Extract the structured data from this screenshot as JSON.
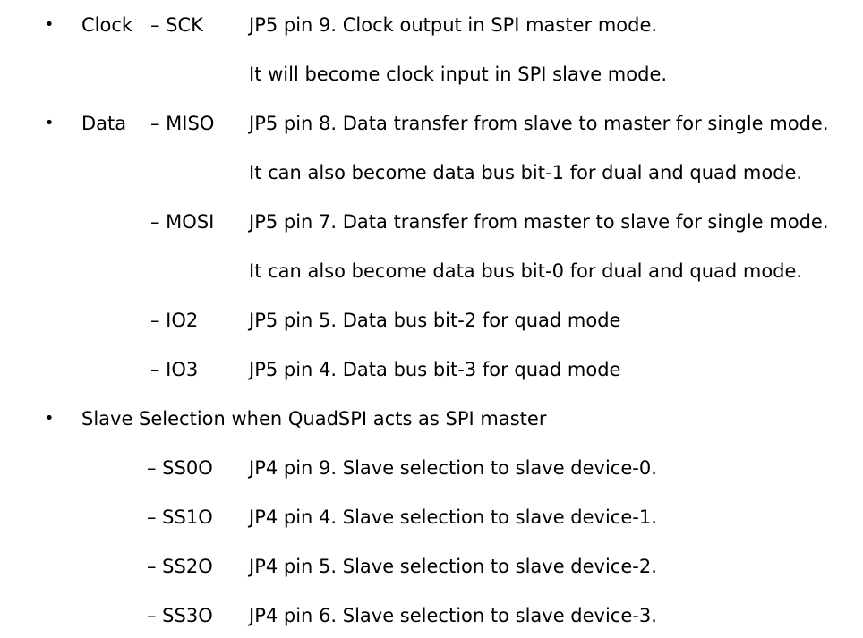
{
  "bullet_glyph": "•",
  "clock": {
    "category": "Clock",
    "signal": "– SCK",
    "lines": [
      "JP5 pin 9. Clock output in SPI master mode.",
      "It will become clock input in SPI slave mode."
    ]
  },
  "data": {
    "category": "Data",
    "signals": [
      {
        "signal": "– MISO",
        "lines": [
          "JP5 pin 8. Data transfer from slave to master for single mode.",
          "It can also become data bus bit-1 for dual and quad mode."
        ]
      },
      {
        "signal": "– MOSI",
        "lines": [
          "JP5 pin 7. Data transfer from master to slave for single mode.",
          "It can also become data bus bit-0 for dual and quad mode."
        ]
      },
      {
        "signal": "– IO2",
        "lines": [
          "JP5 pin 5. Data bus bit-2 for quad mode"
        ]
      },
      {
        "signal": "– IO3",
        "lines": [
          "JP5 pin 4. Data bus bit-3 for quad mode"
        ]
      }
    ]
  },
  "slave_selection": {
    "heading": "Slave Selection when QuadSPI acts as SPI master",
    "signals": [
      {
        "signal": "– SS0O",
        "line": "JP4 pin 9. Slave selection to slave device-0."
      },
      {
        "signal": "– SS1O",
        "line": "JP4 pin 4. Slave selection to slave device-1."
      },
      {
        "signal": "– SS2O",
        "line": "JP4 pin 5. Slave selection to slave device-2."
      },
      {
        "signal": "– SS3O",
        "line": "JP4 pin 6. Slave selection to slave device-3."
      }
    ]
  }
}
